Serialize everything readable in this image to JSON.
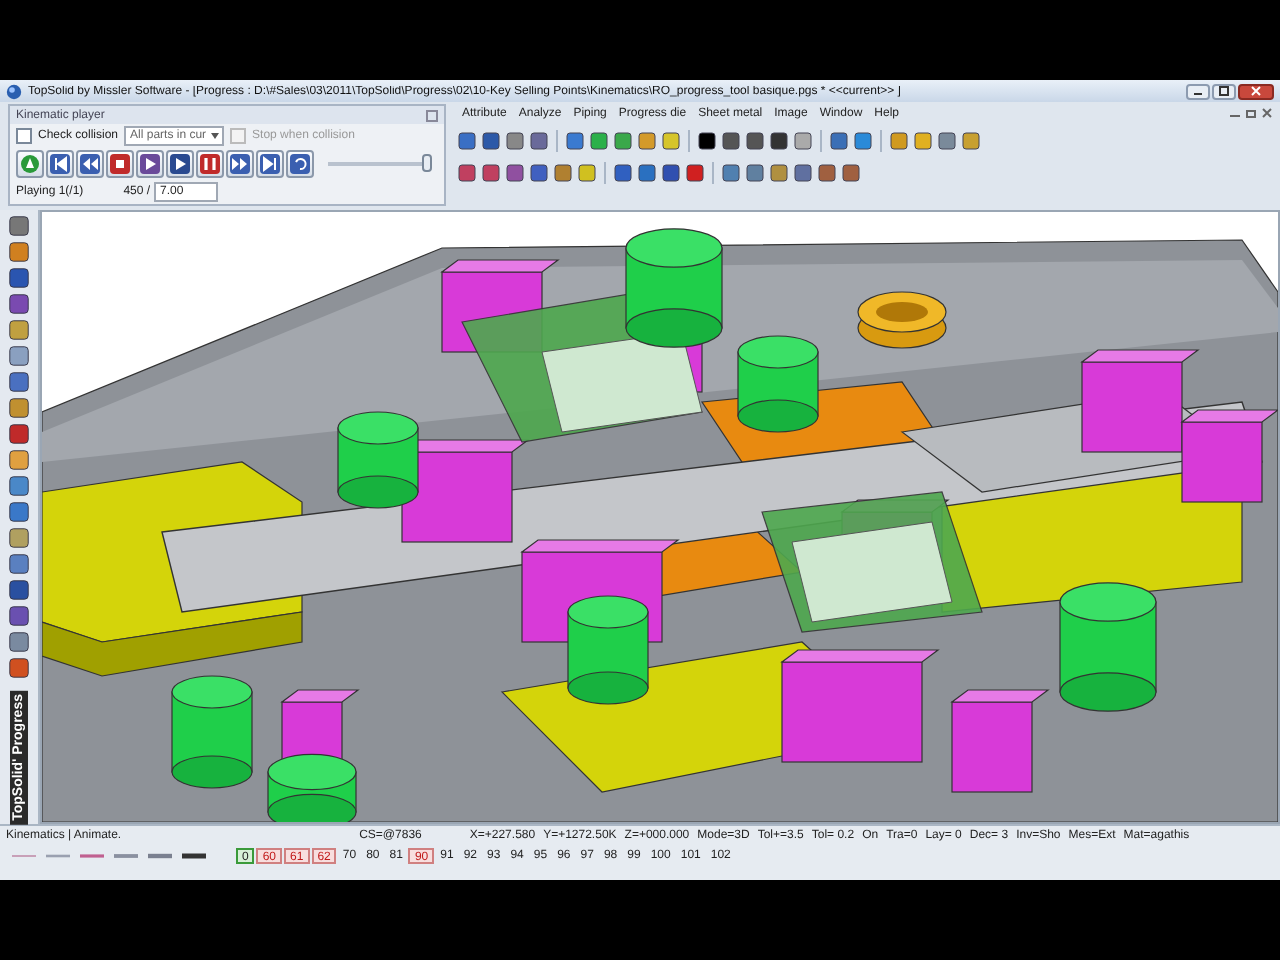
{
  "window": {
    "title": "TopSolid by Missler Software - [Progress : D:\\#Sales\\03\\2011\\TopSolid\\Progress\\02\\10-Key Selling Points\\Kinematics\\RO_progress_tool basique.pgs * <<current>> ]"
  },
  "kinematic_player": {
    "title": "Kinematic player",
    "check_collision": {
      "label": "Check collision",
      "checked": false
    },
    "scope": {
      "value": "All parts in cur"
    },
    "stop_when_collision": {
      "label": "Stop when collision",
      "checked": false,
      "disabled": true
    },
    "slider": {
      "level": 0.96
    },
    "status": "Playing 1(/1)",
    "frame": "450 /",
    "speed": {
      "value": "7.00"
    }
  },
  "menu": [
    "Attribute",
    "Analyze",
    "Piping",
    "Progress die",
    "Sheet metal",
    "Image",
    "Window",
    "Help"
  ],
  "side_label": "TopSolid' Progress",
  "status_bar": {
    "mode": "Kinematics | Animate.",
    "cs": "CS=@7836",
    "fields": [
      "X=+227.580",
      "Y=+1272.50K",
      "Z=+000.000",
      "Mode=3D",
      "Tol+=3.5",
      "Tol= 0.2",
      "On",
      "Tra=0",
      "Lay= 0",
      "Dec= 3",
      "Inv=Sho",
      "Mes=Ext",
      "Mat=agathis"
    ]
  },
  "layers": [
    {
      "label": "0",
      "kind": "current"
    },
    {
      "label": "60",
      "kind": "marked"
    },
    {
      "label": "61",
      "kind": "marked"
    },
    {
      "label": "62",
      "kind": "marked"
    },
    {
      "label": "70",
      "kind": "plain"
    },
    {
      "label": "80",
      "kind": "plain"
    },
    {
      "label": "81",
      "kind": "plain"
    },
    {
      "label": "90",
      "kind": "marked"
    },
    {
      "label": "91",
      "kind": "plain"
    },
    {
      "label": "92",
      "kind": "plain"
    },
    {
      "label": "93",
      "kind": "plain"
    },
    {
      "label": "94",
      "kind": "plain"
    },
    {
      "label": "95",
      "kind": "plain"
    },
    {
      "label": "96",
      "kind": "plain"
    },
    {
      "label": "97",
      "kind": "plain"
    },
    {
      "label": "98",
      "kind": "plain"
    },
    {
      "label": "99",
      "kind": "plain"
    },
    {
      "label": "100",
      "kind": "plain"
    },
    {
      "label": "101",
      "kind": "plain"
    },
    {
      "label": "102",
      "kind": "plain"
    }
  ]
}
